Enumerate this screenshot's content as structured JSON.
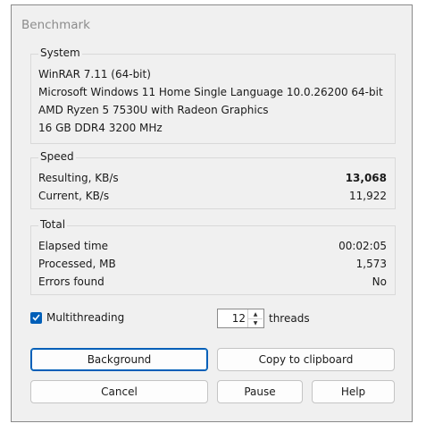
{
  "window": {
    "title": "Benchmark"
  },
  "system": {
    "title": "System",
    "lines": [
      "WinRAR 7.11 (64-bit)",
      "Microsoft Windows 11 Home Single Language 10.0.26200 64-bit",
      "AMD Ryzen 5 7530U with Radeon Graphics",
      "16 GB DDR4 3200 MHz"
    ]
  },
  "speed": {
    "title": "Speed",
    "rows": [
      {
        "label": "Resulting, KB/s",
        "value": "13,068"
      },
      {
        "label": "Current, KB/s",
        "value": "11,922"
      }
    ]
  },
  "total": {
    "title": "Total",
    "rows": [
      {
        "label": "Elapsed time",
        "value": "00:02:05"
      },
      {
        "label": "Processed, MB",
        "value": "1,573"
      },
      {
        "label": "Errors found",
        "value": "No"
      }
    ]
  },
  "options": {
    "multithreading_label": "Multithreading",
    "multithreading_checked": true,
    "threads_value": "12",
    "threads_label": "threads"
  },
  "buttons": {
    "background": "Background",
    "copy": "Copy to clipboard",
    "cancel": "Cancel",
    "pause": "Pause",
    "help": "Help"
  },
  "colors": {
    "accent": "#005fb8",
    "dialog_bg": "#f0f0f0"
  }
}
